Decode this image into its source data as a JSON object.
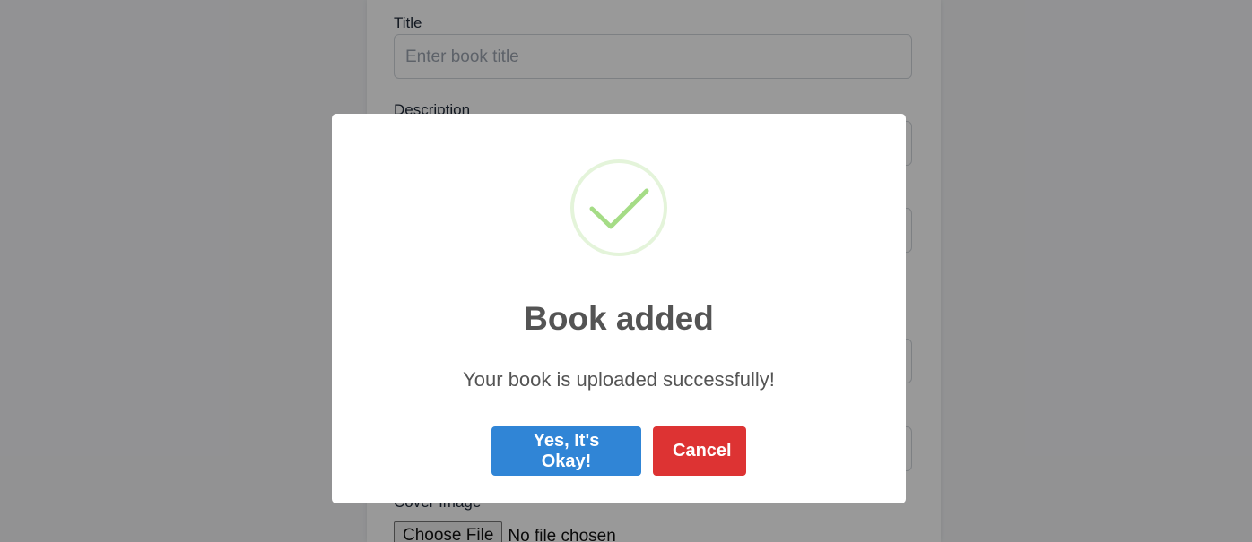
{
  "form": {
    "title_label": "Title",
    "title_placeholder": "Enter book title",
    "description_label": "Description",
    "cover_label": "Cover Image",
    "file_button": "Choose File",
    "file_status": "No file chosen"
  },
  "dialog": {
    "icon": "check-icon",
    "title": "Book added",
    "text": "Your book is uploaded successfully!",
    "confirm_label": "Yes, It's Okay!",
    "cancel_label": "Cancel"
  },
  "colors": {
    "confirm": "#3085d6",
    "cancel": "#dd3333",
    "success": "#a5dc86"
  }
}
